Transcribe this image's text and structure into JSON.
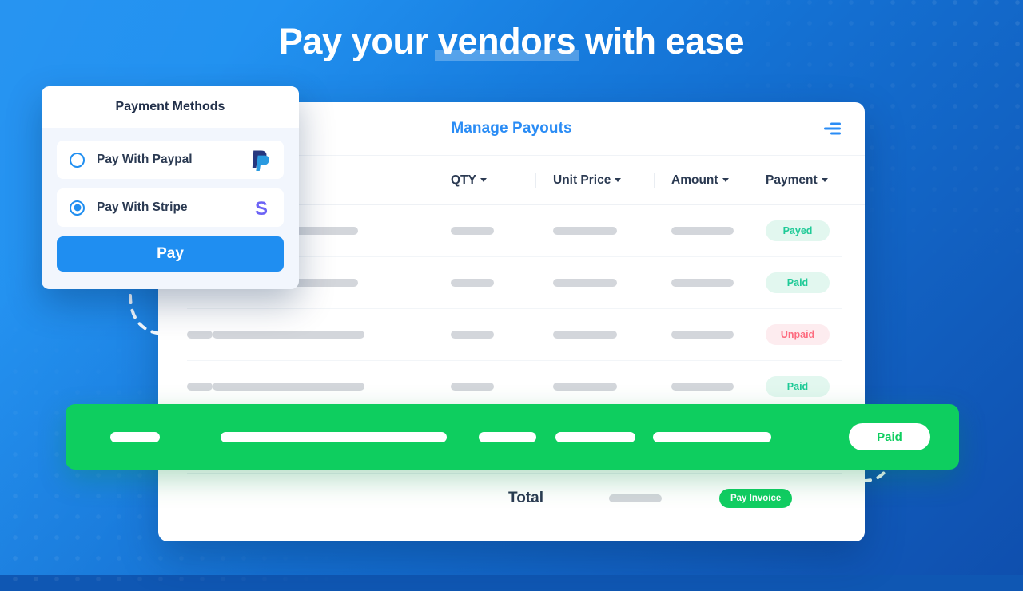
{
  "headline": {
    "before": "Pay your ",
    "highlight": "vendors",
    "after": " with ease"
  },
  "colors": {
    "bg_top_right": "#1b8ef0",
    "bg_bottom_left": "#0f4fae",
    "brand_blue": "#1f8ef1",
    "title_blue": "#2a8cf5",
    "green": "#0ece5f",
    "badge_paid_bg": "#e2f7ef",
    "badge_paid_text": "#1fca97",
    "badge_unpaid_bg": "#fdecef",
    "badge_unpaid_text": "#fd6c7f",
    "pay_invoice_green": "#11ce62",
    "placeholder_gray": "#d3d6db"
  },
  "payment_panel": {
    "title": "Payment Methods",
    "methods": [
      {
        "label": "Pay With Paypal",
        "selected": false,
        "brand_icon": "paypal-icon"
      },
      {
        "label": "Pay With Stripe",
        "selected": true,
        "brand_icon": "stripe-icon"
      }
    ],
    "pay_button_label": "Pay"
  },
  "payouts_card": {
    "title": "Manage Payouts",
    "filter_icon": "filter-lines-icon",
    "columns": [
      {
        "label": "",
        "caret": true
      },
      {
        "label": "QTY",
        "caret": true
      },
      {
        "label": "Unit Price",
        "caret": true
      },
      {
        "label": "Amount",
        "caret": true
      },
      {
        "label": "Payment",
        "caret": true
      }
    ],
    "rows": [
      {
        "has_index": false,
        "status": "Payed",
        "status_type": "paid"
      },
      {
        "has_index": false,
        "status": "Paid",
        "status_type": "paid"
      },
      {
        "has_index": true,
        "status": "Unpaid",
        "status_type": "unpaid"
      },
      {
        "has_index": true,
        "status": "Paid",
        "status_type": "paid"
      }
    ],
    "total": {
      "label": "Total",
      "button_label": "Pay Invoice"
    }
  },
  "highlight_row": {
    "status": "Paid"
  }
}
